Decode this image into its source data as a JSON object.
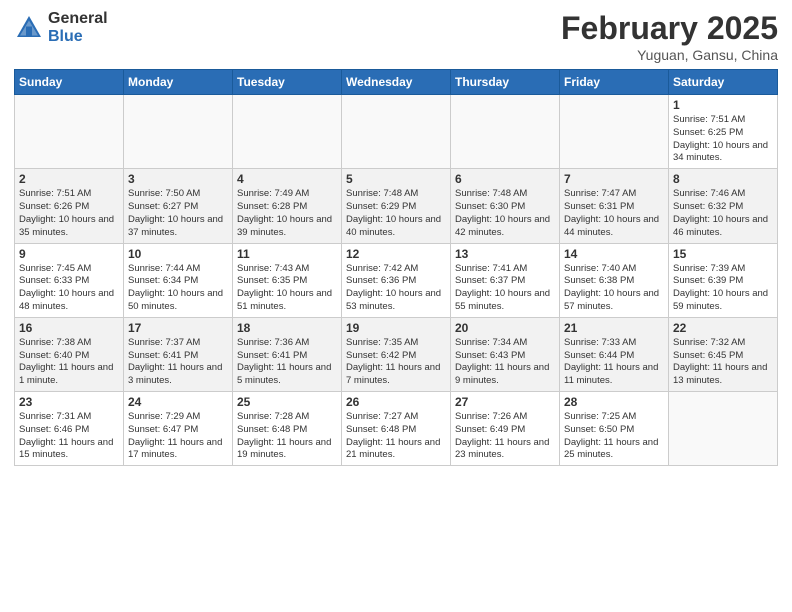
{
  "header": {
    "logo_general": "General",
    "logo_blue": "Blue",
    "title": "February 2025",
    "subtitle": "Yuguan, Gansu, China"
  },
  "weekdays": [
    "Sunday",
    "Monday",
    "Tuesday",
    "Wednesday",
    "Thursday",
    "Friday",
    "Saturday"
  ],
  "weeks": [
    [
      {
        "day": "",
        "info": ""
      },
      {
        "day": "",
        "info": ""
      },
      {
        "day": "",
        "info": ""
      },
      {
        "day": "",
        "info": ""
      },
      {
        "day": "",
        "info": ""
      },
      {
        "day": "",
        "info": ""
      },
      {
        "day": "1",
        "info": "Sunrise: 7:51 AM\nSunset: 6:25 PM\nDaylight: 10 hours and 34 minutes."
      }
    ],
    [
      {
        "day": "2",
        "info": "Sunrise: 7:51 AM\nSunset: 6:26 PM\nDaylight: 10 hours and 35 minutes."
      },
      {
        "day": "3",
        "info": "Sunrise: 7:50 AM\nSunset: 6:27 PM\nDaylight: 10 hours and 37 minutes."
      },
      {
        "day": "4",
        "info": "Sunrise: 7:49 AM\nSunset: 6:28 PM\nDaylight: 10 hours and 39 minutes."
      },
      {
        "day": "5",
        "info": "Sunrise: 7:48 AM\nSunset: 6:29 PM\nDaylight: 10 hours and 40 minutes."
      },
      {
        "day": "6",
        "info": "Sunrise: 7:48 AM\nSunset: 6:30 PM\nDaylight: 10 hours and 42 minutes."
      },
      {
        "day": "7",
        "info": "Sunrise: 7:47 AM\nSunset: 6:31 PM\nDaylight: 10 hours and 44 minutes."
      },
      {
        "day": "8",
        "info": "Sunrise: 7:46 AM\nSunset: 6:32 PM\nDaylight: 10 hours and 46 minutes."
      }
    ],
    [
      {
        "day": "9",
        "info": "Sunrise: 7:45 AM\nSunset: 6:33 PM\nDaylight: 10 hours and 48 minutes."
      },
      {
        "day": "10",
        "info": "Sunrise: 7:44 AM\nSunset: 6:34 PM\nDaylight: 10 hours and 50 minutes."
      },
      {
        "day": "11",
        "info": "Sunrise: 7:43 AM\nSunset: 6:35 PM\nDaylight: 10 hours and 51 minutes."
      },
      {
        "day": "12",
        "info": "Sunrise: 7:42 AM\nSunset: 6:36 PM\nDaylight: 10 hours and 53 minutes."
      },
      {
        "day": "13",
        "info": "Sunrise: 7:41 AM\nSunset: 6:37 PM\nDaylight: 10 hours and 55 minutes."
      },
      {
        "day": "14",
        "info": "Sunrise: 7:40 AM\nSunset: 6:38 PM\nDaylight: 10 hours and 57 minutes."
      },
      {
        "day": "15",
        "info": "Sunrise: 7:39 AM\nSunset: 6:39 PM\nDaylight: 10 hours and 59 minutes."
      }
    ],
    [
      {
        "day": "16",
        "info": "Sunrise: 7:38 AM\nSunset: 6:40 PM\nDaylight: 11 hours and 1 minute."
      },
      {
        "day": "17",
        "info": "Sunrise: 7:37 AM\nSunset: 6:41 PM\nDaylight: 11 hours and 3 minutes."
      },
      {
        "day": "18",
        "info": "Sunrise: 7:36 AM\nSunset: 6:41 PM\nDaylight: 11 hours and 5 minutes."
      },
      {
        "day": "19",
        "info": "Sunrise: 7:35 AM\nSunset: 6:42 PM\nDaylight: 11 hours and 7 minutes."
      },
      {
        "day": "20",
        "info": "Sunrise: 7:34 AM\nSunset: 6:43 PM\nDaylight: 11 hours and 9 minutes."
      },
      {
        "day": "21",
        "info": "Sunrise: 7:33 AM\nSunset: 6:44 PM\nDaylight: 11 hours and 11 minutes."
      },
      {
        "day": "22",
        "info": "Sunrise: 7:32 AM\nSunset: 6:45 PM\nDaylight: 11 hours and 13 minutes."
      }
    ],
    [
      {
        "day": "23",
        "info": "Sunrise: 7:31 AM\nSunset: 6:46 PM\nDaylight: 11 hours and 15 minutes."
      },
      {
        "day": "24",
        "info": "Sunrise: 7:29 AM\nSunset: 6:47 PM\nDaylight: 11 hours and 17 minutes."
      },
      {
        "day": "25",
        "info": "Sunrise: 7:28 AM\nSunset: 6:48 PM\nDaylight: 11 hours and 19 minutes."
      },
      {
        "day": "26",
        "info": "Sunrise: 7:27 AM\nSunset: 6:48 PM\nDaylight: 11 hours and 21 minutes."
      },
      {
        "day": "27",
        "info": "Sunrise: 7:26 AM\nSunset: 6:49 PM\nDaylight: 11 hours and 23 minutes."
      },
      {
        "day": "28",
        "info": "Sunrise: 7:25 AM\nSunset: 6:50 PM\nDaylight: 11 hours and 25 minutes."
      },
      {
        "day": "",
        "info": ""
      }
    ]
  ]
}
